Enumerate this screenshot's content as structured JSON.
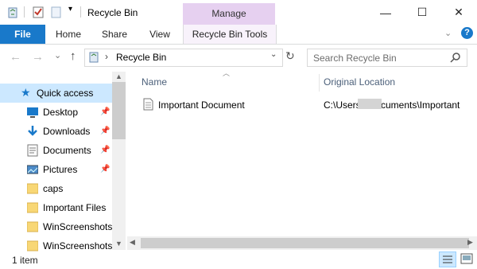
{
  "window": {
    "title": "Recycle Bin",
    "context_group": "Manage",
    "controls": {
      "minimize": "—",
      "maximize": "☐",
      "close": "✕"
    }
  },
  "ribbon": {
    "tabs": [
      {
        "label": "File"
      },
      {
        "label": "Home"
      },
      {
        "label": "Share"
      },
      {
        "label": "View"
      },
      {
        "label": "Recycle Bin Tools"
      }
    ]
  },
  "navigation": {
    "back": "←",
    "forward": "→",
    "recent": "⌄",
    "up": "↑",
    "path_sep": "›",
    "path": "Recycle Bin",
    "search_placeholder": "Search Recycle Bin"
  },
  "nav_pane": {
    "items": [
      {
        "label": "Quick access",
        "icon": "star-icon",
        "pinned": false
      },
      {
        "label": "Desktop",
        "icon": "desktop-icon",
        "pinned": true
      },
      {
        "label": "Downloads",
        "icon": "download-icon",
        "pinned": true
      },
      {
        "label": "Documents",
        "icon": "documents-icon",
        "pinned": true
      },
      {
        "label": "Pictures",
        "icon": "pictures-icon",
        "pinned": true
      },
      {
        "label": "caps",
        "icon": "folder-icon",
        "pinned": false
      },
      {
        "label": "Important Files",
        "icon": "folder-icon",
        "pinned": false
      },
      {
        "label": "WinScreenshots",
        "icon": "folder-icon",
        "pinned": false
      },
      {
        "label": "WinScreenshots",
        "icon": "folder-icon",
        "pinned": false
      }
    ]
  },
  "content": {
    "columns": [
      "Name",
      "Original Location"
    ],
    "rows": [
      {
        "name": "Important Document",
        "location": "C:\\Users\\       \\Documents\\Important"
      }
    ]
  },
  "status": {
    "item_count": "1 item"
  },
  "colors": {
    "accent": "#1979ca",
    "context_band": "#e6d0f0",
    "selected": "#cce8ff"
  }
}
